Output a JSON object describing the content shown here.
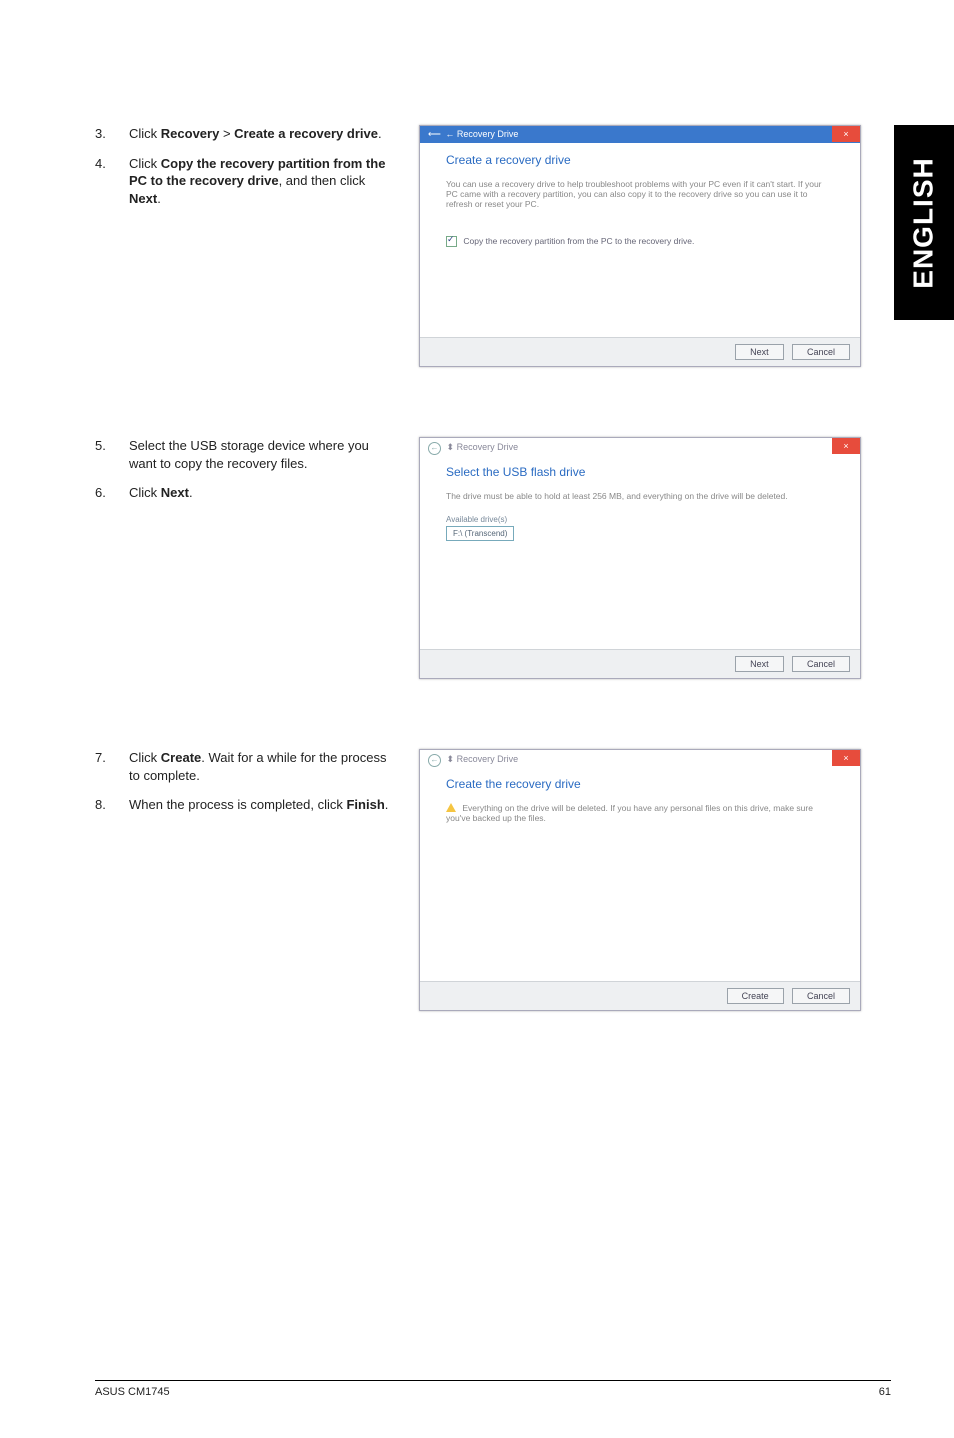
{
  "sideTab": "ENGLISH",
  "section1": {
    "step3": {
      "num": "3.",
      "pre": "Click ",
      "b1": "Recovery",
      "mid": " > ",
      "b2": "Create a recovery drive",
      "post": "."
    },
    "step4": {
      "num": "4.",
      "pre": "Click ",
      "b1": "Copy the recovery partition from the PC to the recovery drive",
      "mid": ", and then click ",
      "b2": "Next",
      "post": "."
    },
    "dialog": {
      "breadcrumb": "← Recovery Drive",
      "heading": "Create a recovery drive",
      "desc": "You can use a recovery drive to help troubleshoot problems with your PC even if it can't start. If your PC came with a recovery partition, you can also copy it to the recovery drive so you can use it to refresh or reset your PC.",
      "checkbox": "Copy the recovery partition from the PC to the recovery drive.",
      "nextBtn": "Next",
      "cancelBtn": "Cancel"
    }
  },
  "section2": {
    "step5": {
      "num": "5.",
      "text": "Select the USB storage device where you want to copy the recovery files."
    },
    "step6": {
      "num": "6.",
      "pre": "Click ",
      "b1": "Next",
      "post": "."
    },
    "dialog": {
      "breadcrumb": "Recovery Drive",
      "heading": "Select the USB flash drive",
      "desc": "The drive must be able to hold at least 256 MB, and everything on the drive will be deleted.",
      "availLabel": "Available drive(s)",
      "driveItem": "F:\\ (Transcend)",
      "nextBtn": "Next",
      "cancelBtn": "Cancel"
    }
  },
  "section3": {
    "step7": {
      "num": "7.",
      "pre": "Click ",
      "b1": "Create",
      "post": ". Wait for a while for the process to complete."
    },
    "step8": {
      "num": "8.",
      "pre": "When the process is completed, click ",
      "b1": "Finish",
      "post": "."
    },
    "dialog": {
      "breadcrumb": "Recovery Drive",
      "heading": "Create the recovery drive",
      "desc": "Everything on the drive will be deleted. If you have any personal files on this drive, make sure you've backed up the files.",
      "createBtn": "Create",
      "cancelBtn": "Cancel"
    }
  },
  "footer": {
    "left": "ASUS CM1745",
    "right": "61"
  }
}
